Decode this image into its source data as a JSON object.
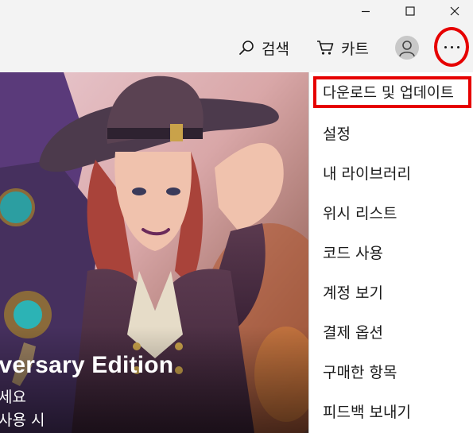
{
  "titlebar": {
    "minimize_icon": "minimize-icon",
    "maximize_icon": "maximize-icon",
    "close_icon": "close-icon"
  },
  "toolbar": {
    "search_label": "검색",
    "cart_label": "카트",
    "account_icon": "avatar-icon",
    "more_icon": "ellipsis-icon",
    "highlight_color": "#e60000"
  },
  "hero": {
    "title": "iversary Edition",
    "line1": "세요",
    "line2": "사용 시"
  },
  "menu": {
    "items": [
      {
        "label": "다운로드 및 업데이트"
      },
      {
        "label": "설정"
      },
      {
        "label": "내 라이브러리"
      },
      {
        "label": "위시 리스트"
      },
      {
        "label": "코드 사용"
      },
      {
        "label": "계정 보기"
      },
      {
        "label": "결제 옵션"
      },
      {
        "label": "구매한 항목"
      },
      {
        "label": "피드백 보내기"
      }
    ]
  }
}
